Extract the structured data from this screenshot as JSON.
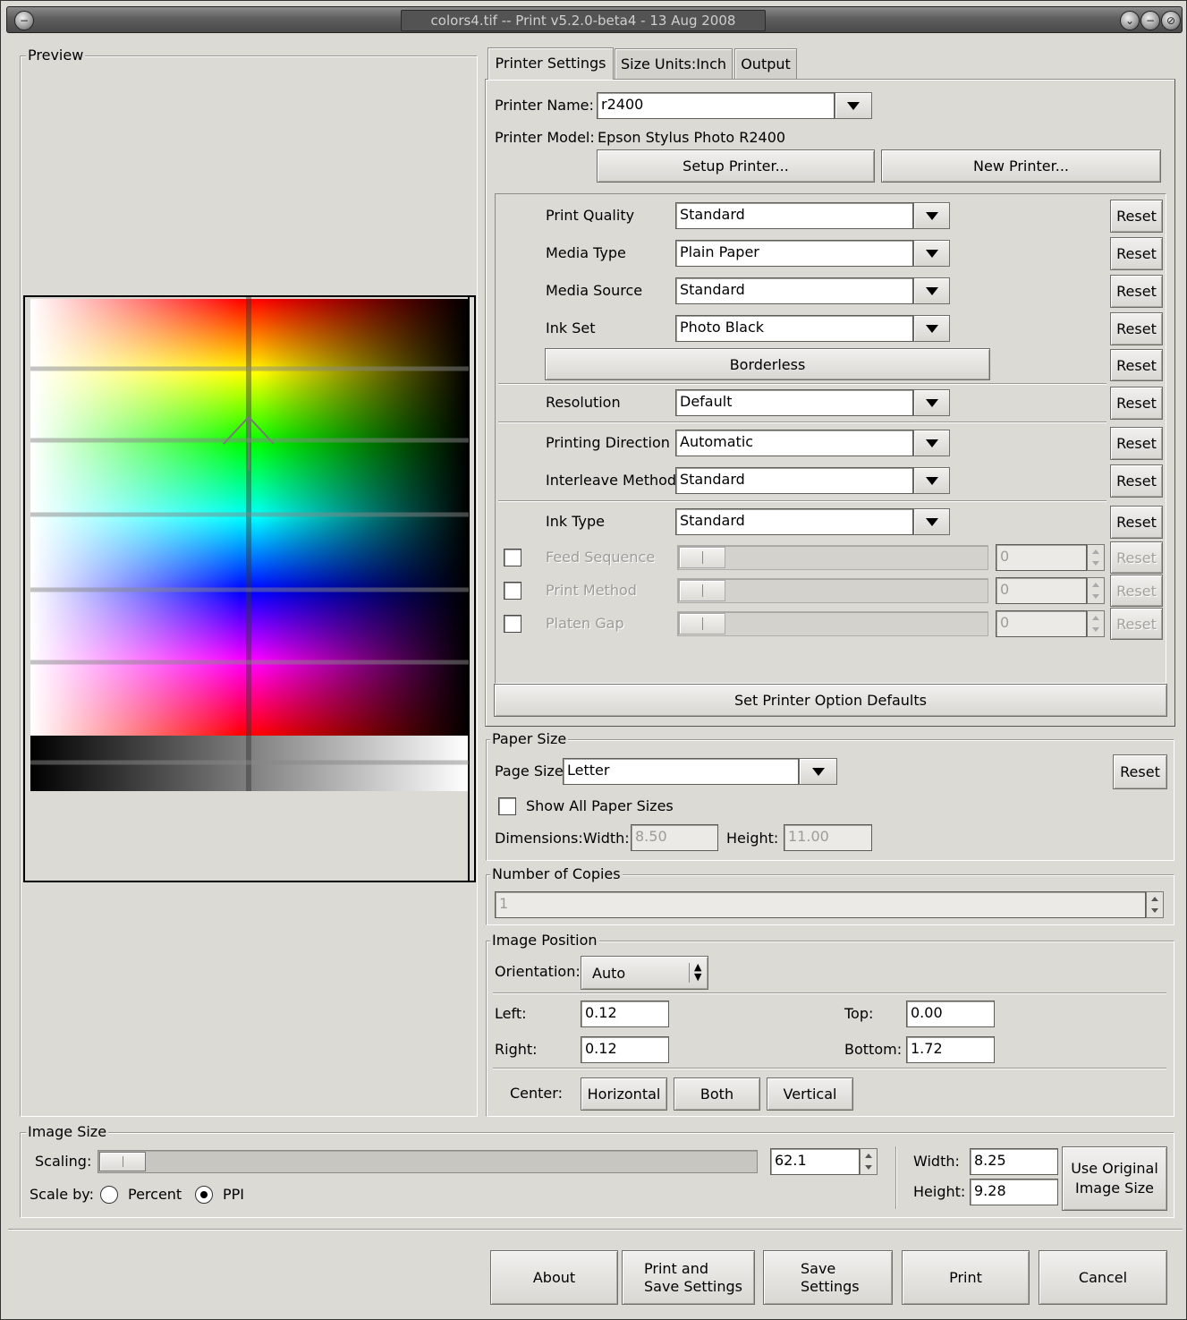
{
  "window": {
    "title": "colors4.tif -- Print v5.2.0-beta4 - 13 Aug 2008"
  },
  "preview": {
    "label": "Preview"
  },
  "tabs": [
    {
      "label": "Printer Settings",
      "active": true
    },
    {
      "label": "Size Units:Inch"
    },
    {
      "label": "Output"
    }
  ],
  "printer": {
    "name_label": "Printer Name:",
    "name_value": "r2400",
    "model_label": "Printer Model:",
    "model_value": "Epson Stylus Photo R2400",
    "setup_button": "Setup Printer...",
    "new_button": "New Printer..."
  },
  "options": {
    "reset": "Reset",
    "print_quality": {
      "label": "Print Quality",
      "value": "Standard"
    },
    "media_type": {
      "label": "Media Type",
      "value": "Plain Paper"
    },
    "media_source": {
      "label": "Media Source",
      "value": "Standard"
    },
    "ink_set": {
      "label": "Ink Set",
      "value": "Photo Black"
    },
    "borderless": "Borderless",
    "resolution": {
      "label": "Resolution",
      "value": "Default"
    },
    "printing_direction": {
      "label": "Printing Direction",
      "value": "Automatic"
    },
    "interleave_method": {
      "label": "Interleave Method",
      "value": "Standard"
    },
    "ink_type": {
      "label": "Ink Type",
      "value": "Standard"
    },
    "feed_sequence": {
      "label": "Feed Sequence",
      "value": "0"
    },
    "print_method": {
      "label": "Print Method",
      "value": "0"
    },
    "platen_gap": {
      "label": "Platen Gap",
      "value": "0"
    },
    "set_defaults": "Set Printer Option Defaults"
  },
  "paper": {
    "group_label": "Paper Size",
    "page_size_label": "Page Size",
    "page_size_value": "Letter",
    "reset": "Reset",
    "show_all": "Show All Paper Sizes",
    "dimensions_label": "Dimensions:Width:",
    "width": "8.50",
    "height_label": "Height:",
    "height": "11.00"
  },
  "copies": {
    "group_label": "Number of Copies",
    "value": "1"
  },
  "position": {
    "group_label": "Image Position",
    "orientation_label": "Orientation:",
    "orientation_value": "Auto",
    "left_label": "Left:",
    "left": "0.12",
    "top_label": "Top:",
    "top": "0.00",
    "right_label": "Right:",
    "right": "0.12",
    "bottom_label": "Bottom:",
    "bottom": "1.72",
    "center_label": "Center:",
    "horizontal": "Horizontal",
    "both": "Both",
    "vertical": "Vertical"
  },
  "image_size": {
    "group_label": "Image Size",
    "scaling_label": "Scaling:",
    "scaling_value": "62.1",
    "scale_by_label": "Scale by:",
    "percent": "Percent",
    "ppi": "PPI",
    "selected": "PPI",
    "width_label": "Width:",
    "width": "8.25",
    "height_label": "Height:",
    "height": "9.28",
    "use_original_line1": "Use Original",
    "use_original_line2": "Image Size"
  },
  "actions": {
    "about": "About",
    "print_and_save_line1": "Print and",
    "print_and_save_line2": "Save Settings",
    "save_line1": "Save",
    "save_line2": "Settings",
    "print": "Print",
    "cancel": "Cancel"
  }
}
